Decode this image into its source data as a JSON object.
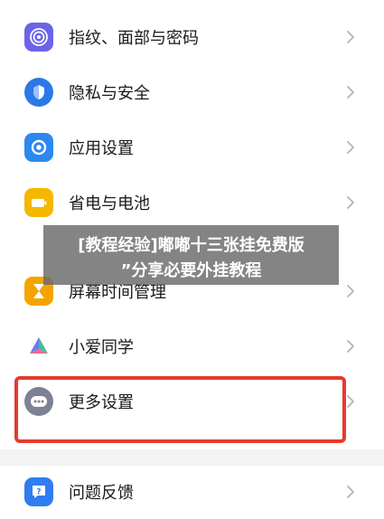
{
  "settings": {
    "items": [
      {
        "label": "指纹、面部与密码",
        "icon": "fingerprint-icon",
        "color": "#6c64e8"
      },
      {
        "label": "隐私与安全",
        "icon": "privacy-shield-icon",
        "color": "#2c78e8"
      },
      {
        "label": "应用设置",
        "icon": "app-settings-icon",
        "color": "#2c88ee"
      },
      {
        "label": "省电与电池",
        "icon": "battery-icon",
        "color": "#f5b800"
      },
      {
        "label": "屏幕时间管理",
        "icon": "hourglass-icon",
        "color": "#f5a300"
      },
      {
        "label": "小爱同学",
        "icon": "xiaoai-assistant-icon",
        "color": "#5b7cf0"
      },
      {
        "label": "更多设置",
        "icon": "more-dots-icon",
        "color": "#7c8294"
      },
      {
        "label": "问题反馈",
        "icon": "feedback-icon",
        "color": "#2f7df0"
      }
    ]
  },
  "overlay": {
    "line1": "[教程经验]嘟嘟十三张挂免费版",
    "line2": "”分享必要外挂教程"
  },
  "colors": {
    "highlight": "#e63a2e",
    "chevron": "#b5b5b5"
  }
}
